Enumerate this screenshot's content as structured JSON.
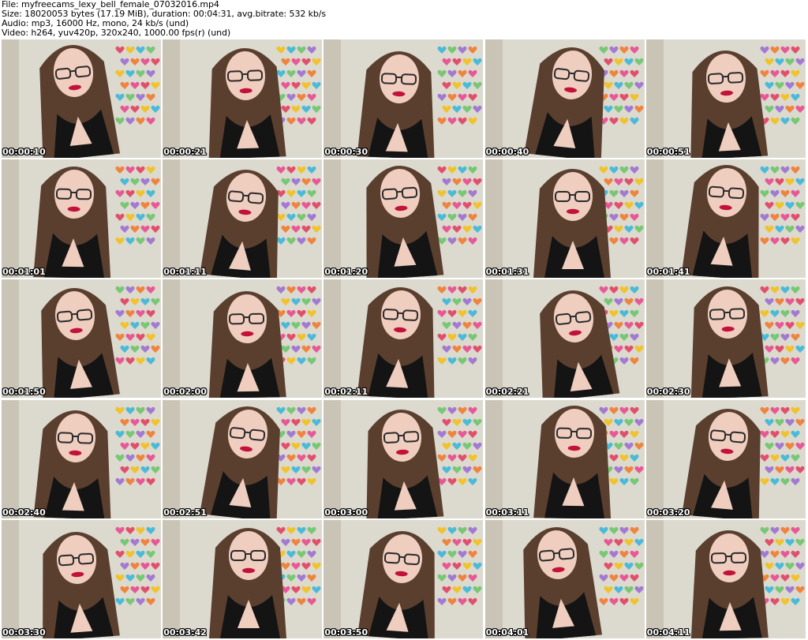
{
  "header": {
    "file": "File: myfreecams_lexy_bell_female_07032016.mp4",
    "size": "Size: 18020053 bytes (17.19 MiB), duration: 00:04:31, avg.bitrate: 532 kb/s",
    "audio": "Audio: mp3, 16000 Hz, mono, 24 kb/s (und)",
    "video": "Video: h264, yuv420p, 320x240, 1000.00 fps(r) (und)"
  },
  "thumbnails": [
    {
      "time": "00:00:10"
    },
    {
      "time": "00:00:21"
    },
    {
      "time": "00:00:30"
    },
    {
      "time": "00:00:40"
    },
    {
      "time": "00:00:51"
    },
    {
      "time": "00:01:01"
    },
    {
      "time": "00:01:11"
    },
    {
      "time": "00:01:20"
    },
    {
      "time": "00:01:31"
    },
    {
      "time": "00:01:41"
    },
    {
      "time": "00:01:50"
    },
    {
      "time": "00:02:00"
    },
    {
      "time": "00:02:11"
    },
    {
      "time": "00:02:21"
    },
    {
      "time": "00:02:30"
    },
    {
      "time": "00:02:40"
    },
    {
      "time": "00:02:51"
    },
    {
      "time": "00:03:00"
    },
    {
      "time": "00:03:11"
    },
    {
      "time": "00:03:20"
    },
    {
      "time": "00:03:30"
    },
    {
      "time": "00:03:42"
    },
    {
      "time": "00:03:50"
    },
    {
      "time": "00:04:01"
    },
    {
      "time": "00:04:11"
    }
  ],
  "colors": {
    "background": "#ffffff",
    "wall": "#dcd9cf",
    "hair": "#5a3f2e",
    "skin": "#efcdbf",
    "dress": "#141414",
    "lips": "#c2123a"
  }
}
